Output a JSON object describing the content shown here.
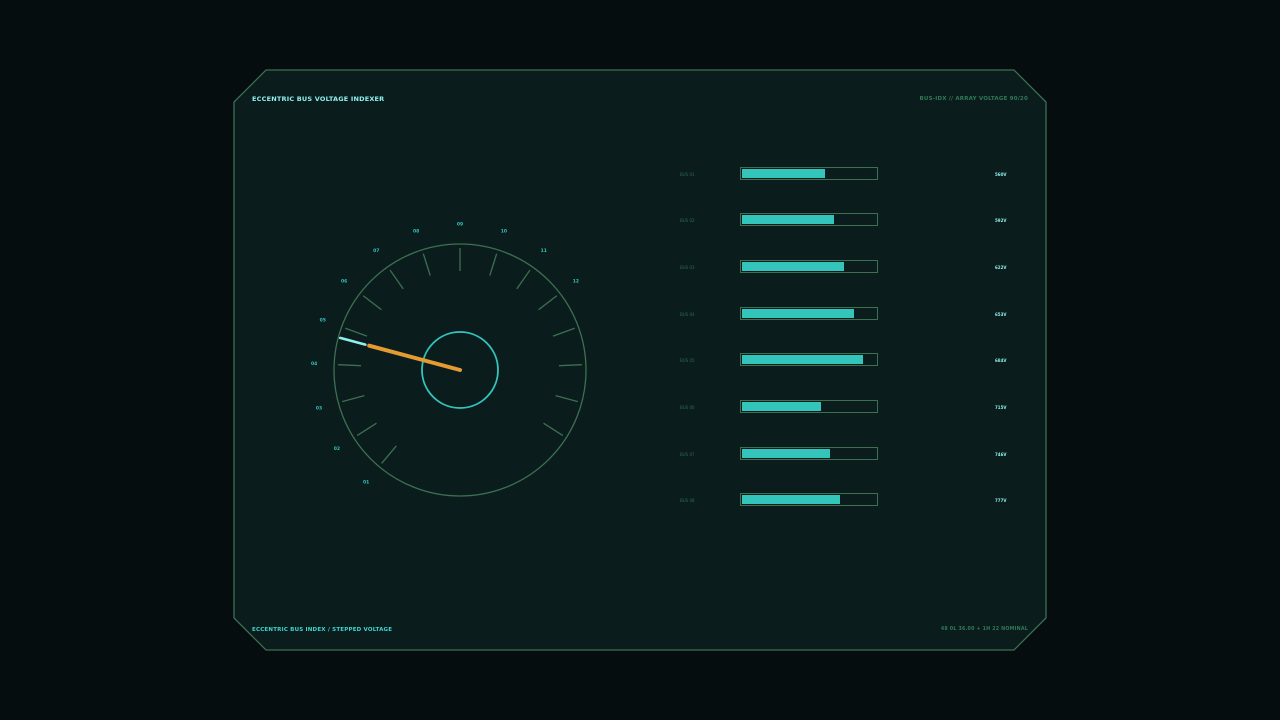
{
  "header": {
    "title": "ECCENTRIC BUS VOLTAGE INDEXER",
    "right": "BUS-IDX // ARRAY VOLTAGE 90/20"
  },
  "footer": {
    "left": "ECCENTRIC BUS INDEX / STEPPED VOLTAGE",
    "right": "48 0L 36.00 + 1H 22 NOMINAL"
  },
  "dial": {
    "labels": [
      "01",
      "02",
      "03",
      "04",
      "05",
      "06",
      "07",
      "08",
      "09",
      "10",
      "11",
      "12"
    ],
    "selected_index": 4,
    "pointer": "04"
  },
  "bars": [
    {
      "label": "BUS 01",
      "value": "560V",
      "level": 0.61
    },
    {
      "label": "BUS 02",
      "value": "592V",
      "level": 0.68
    },
    {
      "label": "BUS 03",
      "value": "622V",
      "level": 0.75
    },
    {
      "label": "BUS 04",
      "value": "653V",
      "level": 0.82
    },
    {
      "label": "BUS 05",
      "value": "684V",
      "level": 0.89
    },
    {
      "label": "BUS 06",
      "value": "715V",
      "level": 0.58
    },
    {
      "label": "BUS 07",
      "value": "746V",
      "level": 0.65
    },
    {
      "label": "BUS 08",
      "value": "777V",
      "level": 0.72
    }
  ],
  "colors": {
    "background": "#050d0f",
    "panel": "#0b1c1d",
    "border": "#3d7050",
    "accent": "#33c4bc",
    "needle": "#e39b32",
    "highlight": "#8ff0ee"
  }
}
